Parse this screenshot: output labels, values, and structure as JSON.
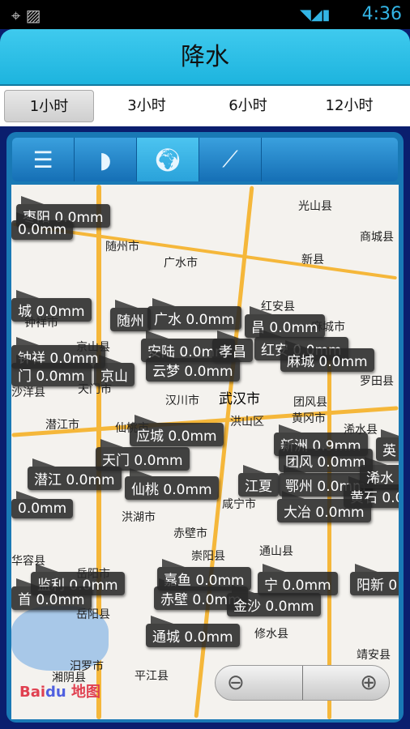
{
  "status": {
    "time": "4:36",
    "icons": [
      "gps-icon",
      "image-icon",
      "wifi-icon",
      "signal-icon",
      "battery-icon"
    ]
  },
  "header": {
    "title": "降水"
  },
  "tabs": [
    {
      "label": "1小时",
      "selected": true
    },
    {
      "label": "3小时"
    },
    {
      "label": "6小时"
    },
    {
      "label": "12小时"
    }
  ],
  "toolbar": {
    "icons": [
      "list-icon",
      "radar-icon",
      "world-map-icon",
      "line-chart-icon"
    ],
    "selected": 2
  },
  "map": {
    "places": [
      "随州市",
      "广水市",
      "光山县",
      "商城县",
      "新县",
      "红安县",
      "麻城市",
      "京山县",
      "天门市",
      "沙洋县",
      "汉川市",
      "武汉市",
      "团风县",
      "罗田县",
      "黄冈市",
      "潜江市",
      "浠水县",
      "咸宁市",
      "洪湖市",
      "赤壁市",
      "崇阳县",
      "通山县",
      "岳阳市",
      "岳阳县",
      "修水县",
      "汨罗市",
      "湘阴县",
      "平江县",
      "靖安县",
      "华容县",
      "钟祥市",
      "仙桃市",
      "洪山区"
    ],
    "markers": [
      "枣阳 0.0mm",
      "0.0mm",
      "城 0.0mm",
      "随州",
      "广水 0.0mm",
      "昌 0.0mm",
      "安陆 0.0mm",
      "孝昌",
      "红安 0.0mm",
      "麻城 0.0mm",
      "钟祥 0.0mm",
      "门 0.0mm",
      "京山",
      "云梦 0.0mm",
      "应城 0.0mm",
      "新洲 0.9mm",
      "天门 0.0mm",
      "团风 0.0mm",
      "潜江 0.0mm",
      "仙桃 0.0mm",
      "江夏",
      "鄂州 0.0mm",
      "黄石 0.0",
      "大冶 0.0mm",
      "0.0mm",
      "监利 0.0mm",
      "嘉鱼 0.0mm",
      "宁 0.0mm",
      "阳新 0",
      "首 0.0mm",
      "赤壁 0.0mm",
      "金沙 0.0mm",
      "通城 0.0mm",
      "英",
      "浠水 0"
    ],
    "logo": "Bai du 地图",
    "zoom_out": "⊖",
    "zoom_in": "⊕"
  }
}
